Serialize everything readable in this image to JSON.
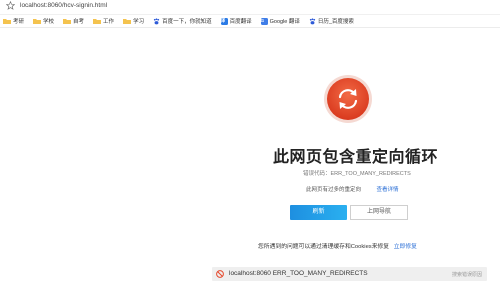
{
  "address_bar": {
    "url": "localhost:8060/hcv-signin.html"
  },
  "bookmarks": [
    {
      "label": "考研",
      "icon": "folder-icon"
    },
    {
      "label": "学校",
      "icon": "folder-icon"
    },
    {
      "label": "自考",
      "icon": "folder-icon"
    },
    {
      "label": "工作",
      "icon": "folder-icon"
    },
    {
      "label": "学习",
      "icon": "folder-icon"
    },
    {
      "label": "百度一下，你就知道",
      "icon": "paw-icon"
    },
    {
      "label": "百度翻译",
      "icon": "baidu-translate-icon"
    },
    {
      "label": "Google 翻译",
      "icon": "google-translate-icon"
    },
    {
      "label": "日历_百度搜索",
      "icon": "baidu-calendar-icon"
    }
  ],
  "error_page": {
    "title": "此网页包含重定向循环",
    "error_code": "错误代码：ERR_TOO_MANY_REDIRECTS",
    "redirect_text": "此网页有过多的重定向",
    "details_link": "查看详情",
    "refresh_button": "刷新",
    "back_button": "上网导航",
    "fix_text": "您所遇到的问题可以通过清理缓存和Cookies来修复",
    "fix_link": "立即修复"
  },
  "error_bar": {
    "text": "localhost:8060 ERR_TOO_MANY_REDIRECTS",
    "right_text": "搜索错误原因"
  },
  "colors": {
    "accent_blue": "#2ab0f0",
    "link_blue": "#2b6fd6",
    "error_red": "#e64a2e"
  }
}
